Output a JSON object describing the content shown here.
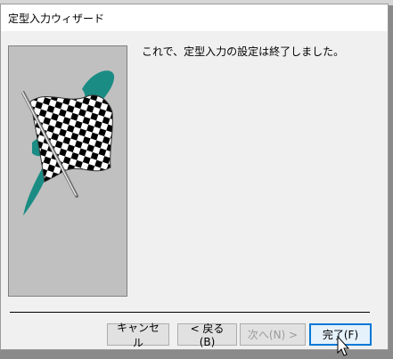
{
  "window": {
    "title": "定型入力ウィザード"
  },
  "main": {
    "message": "これで、定型入力の設定は終了しました。"
  },
  "buttons": {
    "cancel": "キャンセル",
    "back": "< 戻る(B)",
    "next": "次へ(N) >",
    "finish": "完了(F)"
  },
  "colors": {
    "flag_teal": "#1a8c84",
    "default_button_border": "#0078d7"
  },
  "icons": {
    "wizard_image": "checkered-flag-icon"
  }
}
